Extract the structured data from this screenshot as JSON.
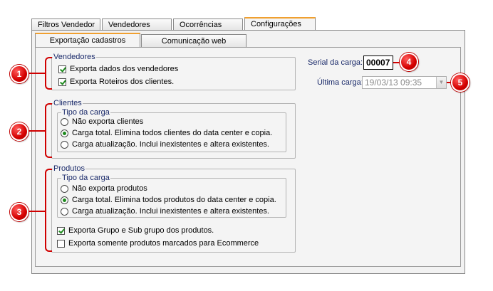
{
  "tabs": [
    {
      "label": "Filtros Vendedor"
    },
    {
      "label": "Vendedores"
    },
    {
      "label": "Ocorrências"
    },
    {
      "label": "Configurações"
    }
  ],
  "subtabs": [
    {
      "label": "Exportação cadastros"
    },
    {
      "label": "Comunicação web"
    }
  ],
  "vendedores": {
    "legend": "Vendedores",
    "opt1": "Exporta dados dos vendedores",
    "opt2": "Exporta Roteiros dos clientes."
  },
  "clientes": {
    "legend": "Clientes",
    "sublegend": "Tipo da carga",
    "opt1": "Não exporta clientes",
    "opt2": "Carga total. Elimina todos clientes do data center e copia.",
    "opt3": "Carga atualização. Inclui inexistentes e altera existentes."
  },
  "produtos": {
    "legend": "Produtos",
    "sublegend": "Tipo da carga",
    "opt1": "Não exporta produtos",
    "opt2": "Carga total. Elimina todos produtos do data center e copia.",
    "opt3": "Carga atualização. Inclui inexistentes e altera existentes.",
    "chk1": "Exporta Grupo e Sub grupo dos produtos.",
    "chk2": "Exporta somente produtos marcados para Ecommerce"
  },
  "right": {
    "serial_label": "Serial da carga:",
    "serial_value": "00007",
    "ultima_label": "Última carga:",
    "ultima_value": "19/03/13 09:35"
  },
  "markers": [
    "1",
    "2",
    "3",
    "4",
    "5"
  ],
  "colors": {
    "accent": "#f0a030",
    "marker": "#d00000",
    "check": "#1e8a1e"
  }
}
